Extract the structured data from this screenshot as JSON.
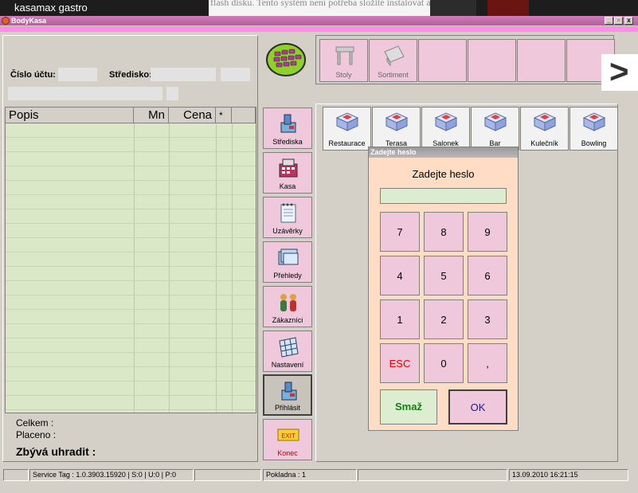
{
  "overlay": {
    "caption": "kasamax gastro",
    "background_text": "flash disku. Tento systém není potřeba složité instalovat a běží na jakémkoliv PC se systémem"
  },
  "window": {
    "title": "BodyKasa",
    "controls": [
      "_",
      "▫",
      "x"
    ]
  },
  "account": {
    "account_label": "Číslo účtu:",
    "center_label": "Středisko:"
  },
  "grid": {
    "columns": [
      "Popis",
      "Mn",
      "Cena",
      "*"
    ]
  },
  "totals": {
    "total_label": "Celkem :",
    "paid_label": "Placeno :",
    "due_label": "Zbývá uhradit :"
  },
  "menu": {
    "items": [
      {
        "label": "Střediska",
        "icon": "register-icon"
      },
      {
        "label": "Kasa",
        "icon": "cash-register-icon"
      },
      {
        "label": "Uzávěrky",
        "icon": "notebook-icon"
      },
      {
        "label": "Přehledy",
        "icon": "folders-icon"
      },
      {
        "label": "Zákazníci",
        "icon": "customers-icon"
      },
      {
        "label": "Nastavení",
        "icon": "settings-grid-icon"
      },
      {
        "label": "Přihlásit",
        "icon": "login-icon"
      },
      {
        "label": "Konec",
        "icon": "exit-icon"
      }
    ],
    "keypad_logo": "keypad-logo-icon"
  },
  "toolbar": {
    "items": [
      {
        "label": "Stoly",
        "icon": "table-icon"
      },
      {
        "label": "Sortiment",
        "icon": "assortment-icon"
      },
      {
        "label": ""
      },
      {
        "label": ""
      },
      {
        "label": ""
      },
      {
        "label": ""
      }
    ],
    "next_label": ">"
  },
  "rooms": {
    "items": [
      "Restaurace",
      "Terasa",
      "Salonek",
      "Bar",
      "Kulečník",
      "Bowling"
    ]
  },
  "login_dialog": {
    "title": "Zadejte heslo",
    "heading": "Zadejte heslo",
    "password_value": "",
    "keys": [
      "7",
      "8",
      "9",
      "4",
      "5",
      "6",
      "1",
      "2",
      "3",
      "ESC",
      "0",
      ","
    ],
    "delete_label": "Smaž",
    "ok_label": "OK"
  },
  "statusbar": {
    "service_tag": "Service Tag : 1.0.3903.15920 | S:0 | U:0 | P:0",
    "register": "Pokladna : 1",
    "datetime": "13.09.2010 16:21:15"
  },
  "colors": {
    "pink_button": "#f0c8dc",
    "grid_green": "#dae8c8",
    "dialog_bg": "#ffdcc4",
    "esc_red": "#e00000",
    "delete_green": "#1a7a1a",
    "ok_blue": "#1a1a9a"
  }
}
